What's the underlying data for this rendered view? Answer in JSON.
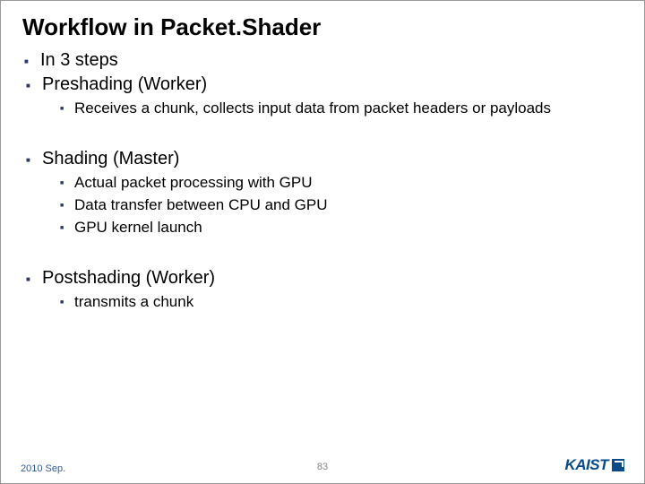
{
  "title": "Workflow in Packet.Shader",
  "bullets": {
    "intro": "In 3 steps",
    "sections": [
      {
        "heading": "Preshading (Worker)",
        "items": [
          "Receives a chunk, collects input data from packet headers or payloads"
        ]
      },
      {
        "heading": "Shading (Master)",
        "items": [
          "Actual packet processing with GPU",
          "Data transfer between CPU and GPU",
          "GPU kernel launch"
        ]
      },
      {
        "heading": "Postshading (Worker)",
        "items": [
          "transmits a chunk"
        ]
      }
    ]
  },
  "footer": {
    "date": "2010 Sep.",
    "page": "83",
    "logo": "KAIST"
  }
}
